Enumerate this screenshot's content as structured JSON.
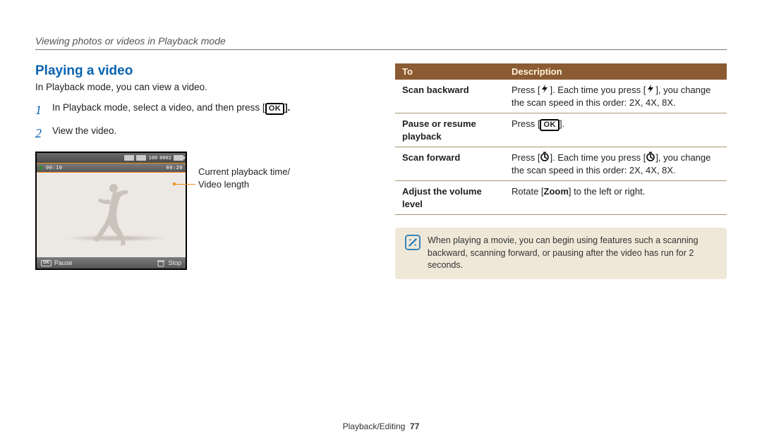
{
  "chapter": "Viewing photos or videos in Playback mode",
  "section_title": "Playing a video",
  "intro": "In Playback mode, you can view a video.",
  "steps": [
    {
      "num": "1",
      "pre": "In Playback mode, select a video, and then press [",
      "ok": "OK",
      "post": "]."
    },
    {
      "num": "2",
      "pre": "View the video.",
      "ok": "",
      "post": ""
    }
  ],
  "screenshot": {
    "top_right_a": "100",
    "top_right_b": "0002",
    "current_time": "00:10",
    "total_time": "00:20",
    "bottom_left_icon": "OK",
    "bottom_left_label": "Pause",
    "bottom_right_label": "Stop"
  },
  "callout": {
    "line1": "Current playback time/",
    "line2": "Video length"
  },
  "table": {
    "head_to": "To",
    "head_desc": "Description",
    "rows": [
      {
        "to": "Scan backward",
        "d1": "Press [",
        "icon": "flash",
        "d2": "]. Each time you press [",
        "icon2": "flash",
        "d3": "], you change the scan speed in this order: 2X, 4X, 8X."
      },
      {
        "to": "Pause or resume playback",
        "d1": "Press [",
        "icon": "ok",
        "d2": "].",
        "icon2": "",
        "d3": ""
      },
      {
        "to": "Scan forward",
        "d1": "Press [",
        "icon": "timer",
        "d2": "]. Each time you press [",
        "icon2": "timer",
        "d3": "], you change the scan speed in this order: 2X, 4X, 8X."
      },
      {
        "to": "Adjust the volume level",
        "d1": "Rotate [",
        "icon": "zoom",
        "d2": "] to the left or right.",
        "icon2": "",
        "d3": ""
      }
    ]
  },
  "note": "When playing a movie, you can begin using features such a scanning backward, scanning forward, or pausing after the video has run for 2 seconds.",
  "footer_section": "Playback/Editing",
  "footer_page": "77"
}
